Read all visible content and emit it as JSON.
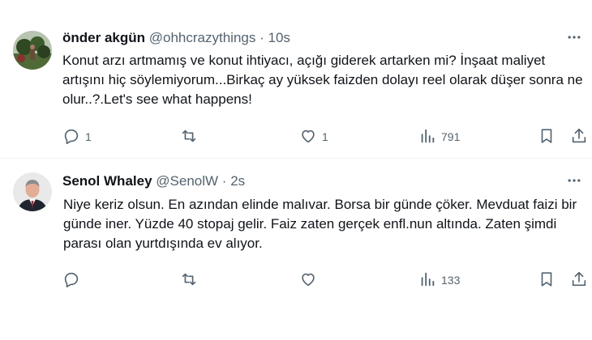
{
  "tweets": [
    {
      "name": "önder akgün",
      "handle": "@ohhcrazythings",
      "time": "10s",
      "text": "Konut arzı artmamış ve konut ihtiyacı, açığı giderek artarken mi? İnşaat maliyet artışını hiç söylemiyorum...Birkaç ay yüksek faizden dolayı reel olarak düşer sonra ne olur..?.Let's see what happens!",
      "replies": "1",
      "retweets": "",
      "likes": "1",
      "views": "791"
    },
    {
      "name": "Senol Whaley",
      "handle": "@SenolW",
      "time": "2s",
      "text": "Niye keriz olsun. En azından elinde malıvar. Borsa bir günde çöker. Mevduat faizi bir günde iner. Yüzde 40 stopaj gelir. Faiz zaten gerçek enfl.nun altında. Zaten şimdi parası olan yurtdışında ev alıyor.",
      "replies": "",
      "retweets": "",
      "likes": "",
      "views": "133"
    }
  ],
  "separator": "·",
  "colors": {
    "text": "#0f1419",
    "secondary": "#536471",
    "divider": "#eff3f4"
  },
  "icons": [
    "more-icon",
    "reply-icon",
    "retweet-icon",
    "like-icon",
    "views-icon",
    "bookmark-icon",
    "share-icon"
  ]
}
